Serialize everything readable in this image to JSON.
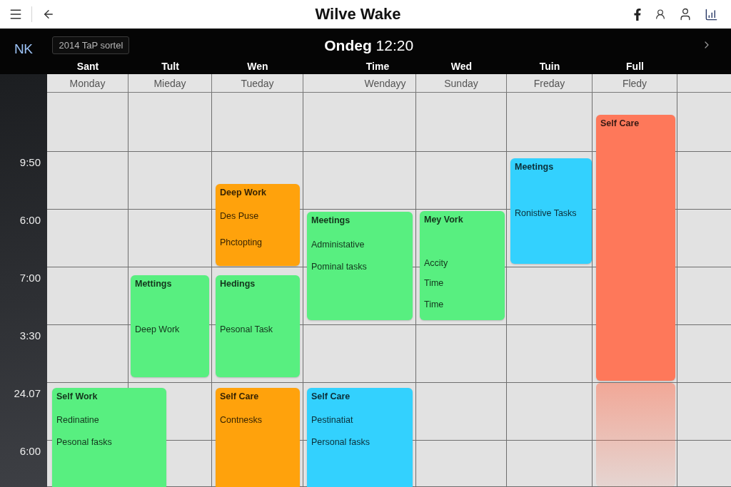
{
  "top_bar": {
    "title": "Wilve Wake"
  },
  "header": {
    "logo_text": "NK",
    "date_chip": "2014 TaP sortel",
    "heading": "**Ondeg** 12:20"
  },
  "columns": [
    {
      "short_label": "Sant",
      "day": "Monday"
    },
    {
      "short_label": "Tult",
      "day": "Mieday"
    },
    {
      "short_label": "Wen",
      "day": "Tueday"
    },
    {
      "short_label": "Time",
      "day": "Wendayy"
    },
    {
      "short_label": "Wed",
      "day": "Sunday"
    },
    {
      "short_label": "Tuin",
      "day": "Freday"
    },
    {
      "short_label": "Full",
      "day": "Fledy"
    }
  ],
  "time_labels": [
    "9:50",
    "6:00",
    "7:00",
    "3:30",
    "24.07",
    "6:00"
  ],
  "events": [
    {
      "title": "Self Care",
      "color": "#fe785a"
    },
    {
      "title": "Meetings",
      "color": "#33d1fe",
      "lines": [
        "Ronistive Tasks"
      ]
    },
    {
      "title": "Deep Work",
      "color": "#ffa20c",
      "lines": [
        "Des Puse",
        "Phctopting"
      ]
    },
    {
      "title": "Meetings",
      "color": "#58ef80",
      "lines": [
        "Administative",
        "Pominal tasks"
      ]
    },
    {
      "title": "Mey Vork",
      "color": "#58ef80",
      "lines": [
        "Accity",
        "Time",
        "Time"
      ]
    },
    {
      "title": "Mettings",
      "color": "#58ef80",
      "lines": [
        "Deep Work"
      ]
    },
    {
      "title": "Hedings",
      "color": "#58ef80",
      "lines": [
        "Pesonal Task"
      ]
    },
    {
      "title": "Self Work",
      "color": "#58ef80",
      "lines": [
        "Redinatine",
        "Pesonal fasks"
      ]
    },
    {
      "title": "Self Care",
      "color": "#ffa20c",
      "lines": [
        "Contnesks"
      ]
    },
    {
      "title": "Self Care",
      "color": "#33d1fe",
      "lines": [
        "Pestinatiat",
        "Personal fasks"
      ]
    }
  ]
}
